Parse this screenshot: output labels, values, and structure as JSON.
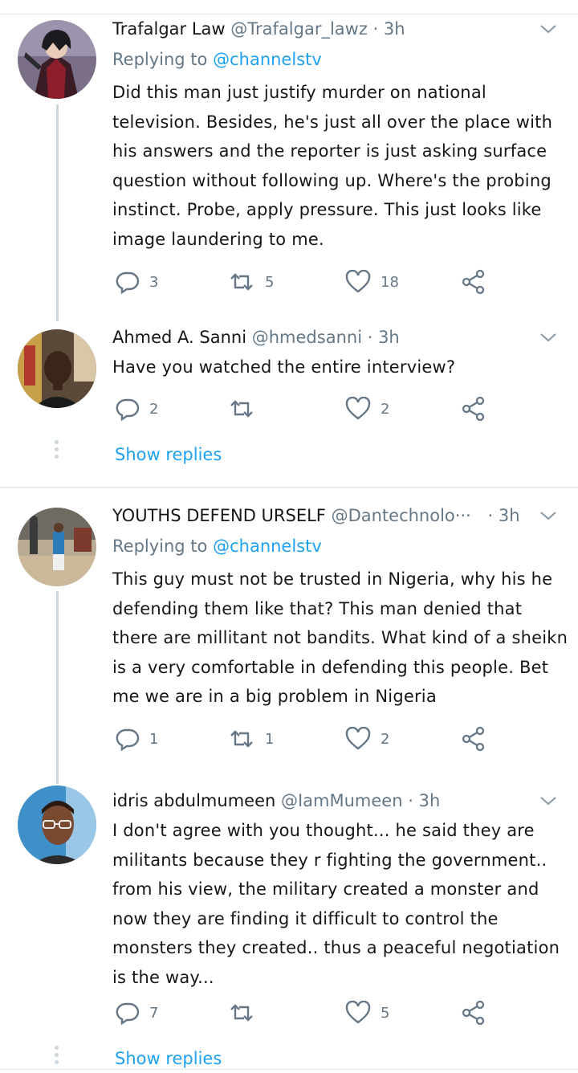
{
  "threads": [
    {
      "parent": {
        "name": "Trafalgar Law",
        "handle": "@Trafalgar_lawz",
        "time": "· 3h",
        "replying_prefix": "Replying to",
        "replying_handle": "@channelstv",
        "text": "Did this man just justify murder on national television. Besides, he's just all over the place with his answers and the reporter is just asking surface question without following up. Where's the probing instinct. Probe, apply pressure. This just looks like image laundering to me.",
        "replies": "3",
        "retweets": "5",
        "likes": "18"
      },
      "child": {
        "name": "Ahmed A. Sanni",
        "handle": "@hmedsanni",
        "time": "· 3h",
        "text": "Have you watched the entire interview?",
        "replies": "2",
        "retweets": "",
        "likes": "2"
      },
      "show_replies": "Show replies"
    },
    {
      "parent": {
        "name": "YOUTHS DEFEND URSELF",
        "handle": "@Dantechnolo···",
        "time": "· 3h",
        "replying_prefix": "Replying to",
        "replying_handle": "@channelstv",
        "text": "This guy must not be trusted in Nigeria, why his he defending them like that? This man denied that there are millitant not bandits. What kind of a sheikn  is a very comfortable in defending this people. Bet me we are in a big problem in Nigeria",
        "replies": "1",
        "retweets": "1",
        "likes": "2"
      },
      "child": {
        "name": "idris abdulmumeen",
        "handle": "@IamMumeen",
        "time": "· 3h",
        "text": "I don't agree with you thought... he said they are militants because they r fighting the government.. from his view, the military created a monster and now they are finding it difficult to control the monsters they created.. thus a peaceful negotiation is the way...",
        "replies": "7",
        "retweets": "",
        "likes": "5"
      },
      "show_replies": "Show replies"
    }
  ],
  "icons": {
    "reply": "reply-icon",
    "retweet": "retweet-icon",
    "like": "like-icon",
    "share": "share-icon",
    "more": "chevron-down-icon"
  },
  "colors": {
    "link": "#1da1f2",
    "muted": "#657786",
    "rail": "#ccd6dd",
    "divider": "#e6ecf0"
  }
}
